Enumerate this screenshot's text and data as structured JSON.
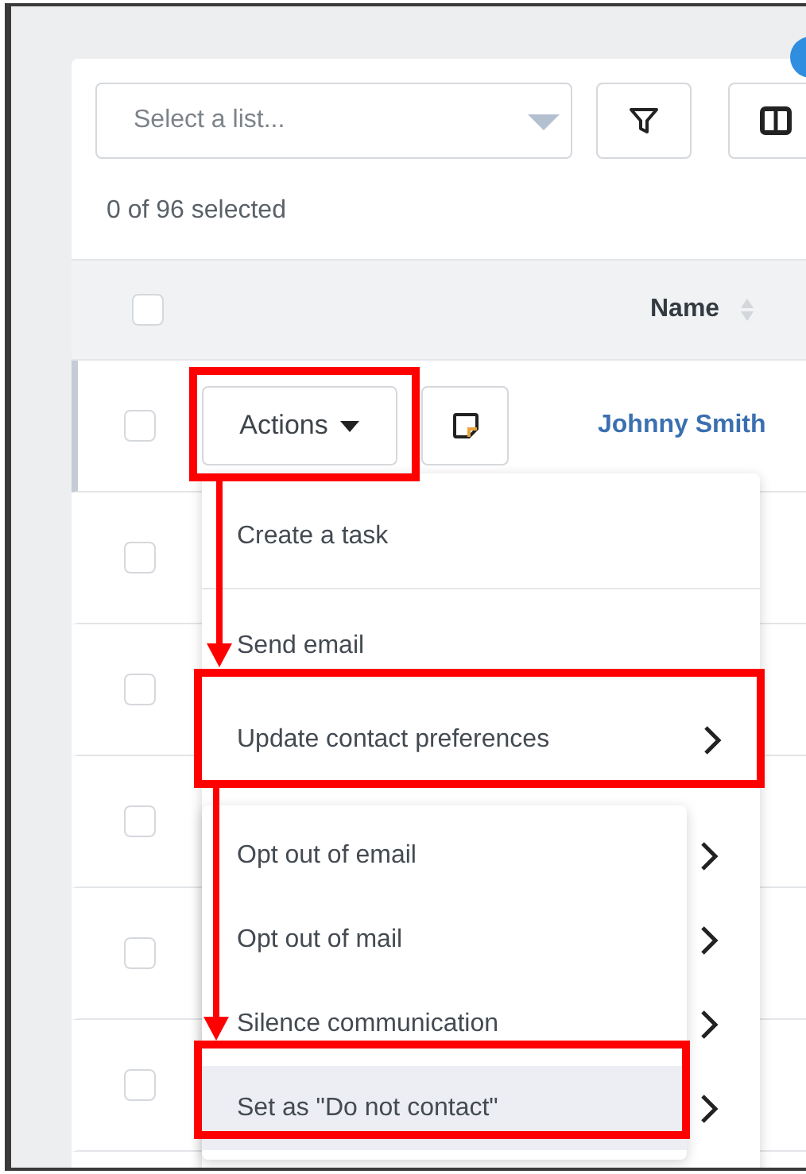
{
  "toolbar": {
    "list_select": {
      "placeholder": "Select a list..."
    }
  },
  "selection_count": "0 of 96 selected",
  "table": {
    "header_checkbox": {
      "checked": false
    },
    "columns": [
      {
        "label": "Name"
      }
    ],
    "rows": [
      {
        "checked": false,
        "active": true,
        "actions_label": "Actions",
        "name": "Johnny Smith"
      },
      {
        "checked": false,
        "active": false
      },
      {
        "checked": false,
        "active": false
      },
      {
        "checked": false,
        "active": false
      },
      {
        "checked": false,
        "active": false
      },
      {
        "checked": false,
        "active": false
      }
    ]
  },
  "actions_menu": {
    "items": [
      {
        "label": "Create a task",
        "kind": "action"
      },
      {
        "label": "Send email",
        "kind": "action"
      },
      {
        "label": "Update contact preferences",
        "kind": "submenu"
      }
    ],
    "submenu": {
      "items": [
        {
          "label": "Opt out of email",
          "selected": false
        },
        {
          "label": "Opt out of mail",
          "selected": false
        },
        {
          "label": "Silence communication",
          "selected": false
        },
        {
          "label": "Set as \"Do not contact\"",
          "selected": true
        }
      ]
    }
  }
}
